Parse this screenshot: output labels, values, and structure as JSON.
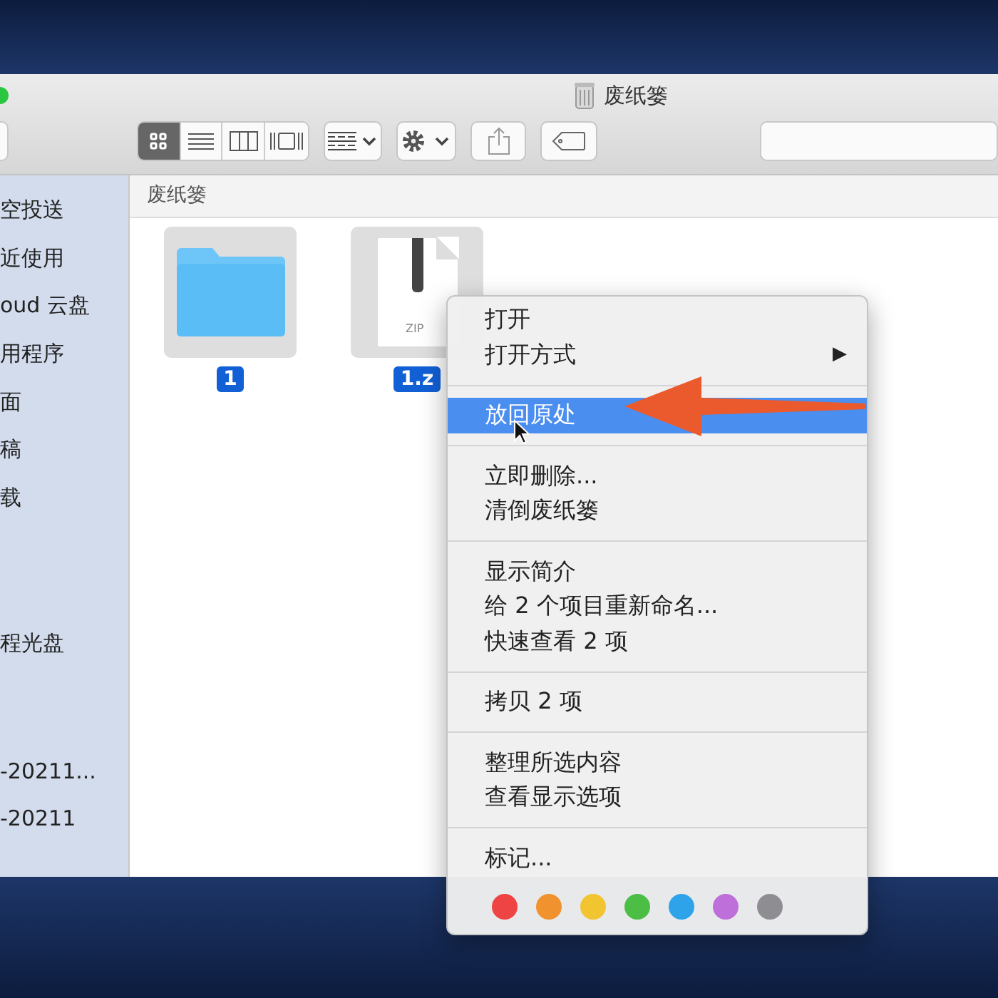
{
  "window": {
    "title": "废纸篓"
  },
  "toolbar": {
    "view_buttons": [
      {
        "kind": "icons",
        "selected": true
      },
      {
        "kind": "list",
        "selected": false
      },
      {
        "kind": "columns",
        "selected": false
      },
      {
        "kind": "gallery",
        "selected": false
      }
    ]
  },
  "sidebar": {
    "sections": [
      {
        "items": [
          "空投送",
          "近使用",
          "oud 云盘",
          "用程序",
          "面",
          "稿",
          "载"
        ]
      },
      {
        "items": [
          "程光盘"
        ]
      },
      {
        "items": [
          "-20211...",
          "-20211"
        ]
      }
    ]
  },
  "path_bar": {
    "label": "废纸篓"
  },
  "files": [
    {
      "kind": "folder",
      "name": "1",
      "selected": true
    },
    {
      "kind": "zip",
      "name": "1.z",
      "selected": true,
      "badge": "ZIP"
    }
  ],
  "context_menu": {
    "groups": [
      [
        {
          "label": "打开",
          "selected": false
        },
        {
          "label": "打开方式",
          "selected": false,
          "submenu": "▶"
        }
      ],
      [
        {
          "label": "放回原处",
          "selected": true
        }
      ],
      [
        {
          "label": "立即删除...",
          "selected": false
        },
        {
          "label": "清倒废纸篓",
          "selected": false
        }
      ],
      [
        {
          "label": "显示简介",
          "selected": false
        },
        {
          "label": "给 2 个项目重新命名...",
          "selected": false
        },
        {
          "label": "快速查看 2 项",
          "selected": false
        }
      ],
      [
        {
          "label": "拷贝 2 项",
          "selected": false
        }
      ],
      [
        {
          "label": "整理所选内容",
          "selected": false
        },
        {
          "label": "查看显示选项",
          "selected": false
        }
      ],
      [
        {
          "label": "标记...",
          "selected": false
        }
      ]
    ],
    "tags": [
      {
        "color": "#ef4444"
      },
      {
        "color": "#f0922e"
      },
      {
        "color": "#f2c530"
      },
      {
        "color": "#4cbe45"
      },
      {
        "color": "#2fa3ea"
      },
      {
        "color": "#bf6fd9"
      },
      {
        "color": "#8e8e92"
      }
    ]
  }
}
